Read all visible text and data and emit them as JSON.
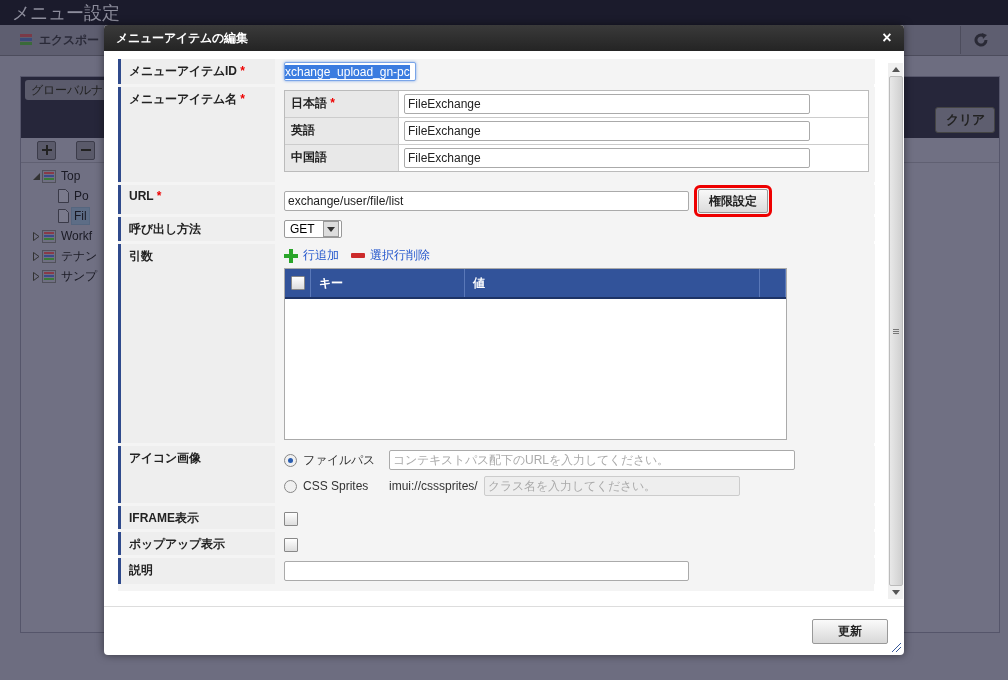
{
  "background": {
    "title": "メニュー設定",
    "toolbar_button": "エクスポー",
    "select": "グローバルナ",
    "clear_button": "クリア",
    "tree": [
      {
        "label": "Top",
        "kind": "folder",
        "expanded": true,
        "selected": false,
        "children": [
          {
            "label": "Po",
            "kind": "page",
            "selected": false
          },
          {
            "label": "Fil",
            "kind": "page",
            "selected": true
          }
        ]
      },
      {
        "label": "Workf",
        "kind": "folder",
        "expanded": false,
        "selected": false
      },
      {
        "label": "テナン",
        "kind": "folder",
        "expanded": false,
        "selected": false
      },
      {
        "label": "サンプ",
        "kind": "folder",
        "expanded": false,
        "selected": false
      }
    ]
  },
  "dialog": {
    "title": "メニューアイテムの編集",
    "close": "×",
    "required_mark": "*",
    "rows": [
      {
        "label": "メニューアイテムID",
        "required": true,
        "kind": "text",
        "value": "xchange_upload_gn-pc",
        "text_selected": true
      },
      {
        "label": "メニューアイテム名",
        "required": true,
        "kind": "languages",
        "languages": [
          {
            "name": "日本語",
            "required": true,
            "value": "FileExchange"
          },
          {
            "name": "英語",
            "required": false,
            "value": "FileExchange"
          },
          {
            "name": "中国語",
            "required": false,
            "value": "FileExchange"
          }
        ]
      },
      {
        "label": "URL",
        "required": true,
        "kind": "url",
        "value": "exchange/user/file/list",
        "button": "権限設定",
        "button_highlighted": true
      },
      {
        "label": "呼び出し方法",
        "required": false,
        "kind": "select",
        "value": "GET"
      },
      {
        "label": "引数",
        "required": false,
        "kind": "grid",
        "add": "行追加",
        "remove": "選択行削除",
        "columns": [
          "キー",
          "値"
        ],
        "header_checked": false
      },
      {
        "label": "アイコン画像",
        "required": false,
        "kind": "icon",
        "options": [
          {
            "label": "ファイルパス",
            "selected": true,
            "placeholder": "コンテキストパス配下のURLを入力してください。",
            "disabled": false
          },
          {
            "label": "CSS Sprites",
            "selected": false,
            "prefix": "imui://csssprites/",
            "placeholder": "クラス名を入力してください。",
            "disabled": true
          }
        ]
      },
      {
        "label": "IFRAME表示",
        "required": false,
        "kind": "checkbox",
        "checked": false
      },
      {
        "label": "ポップアップ表示",
        "required": false,
        "kind": "checkbox",
        "checked": false
      },
      {
        "label": "説明",
        "required": false,
        "kind": "text_wide"
      }
    ],
    "submit": "更新"
  }
}
